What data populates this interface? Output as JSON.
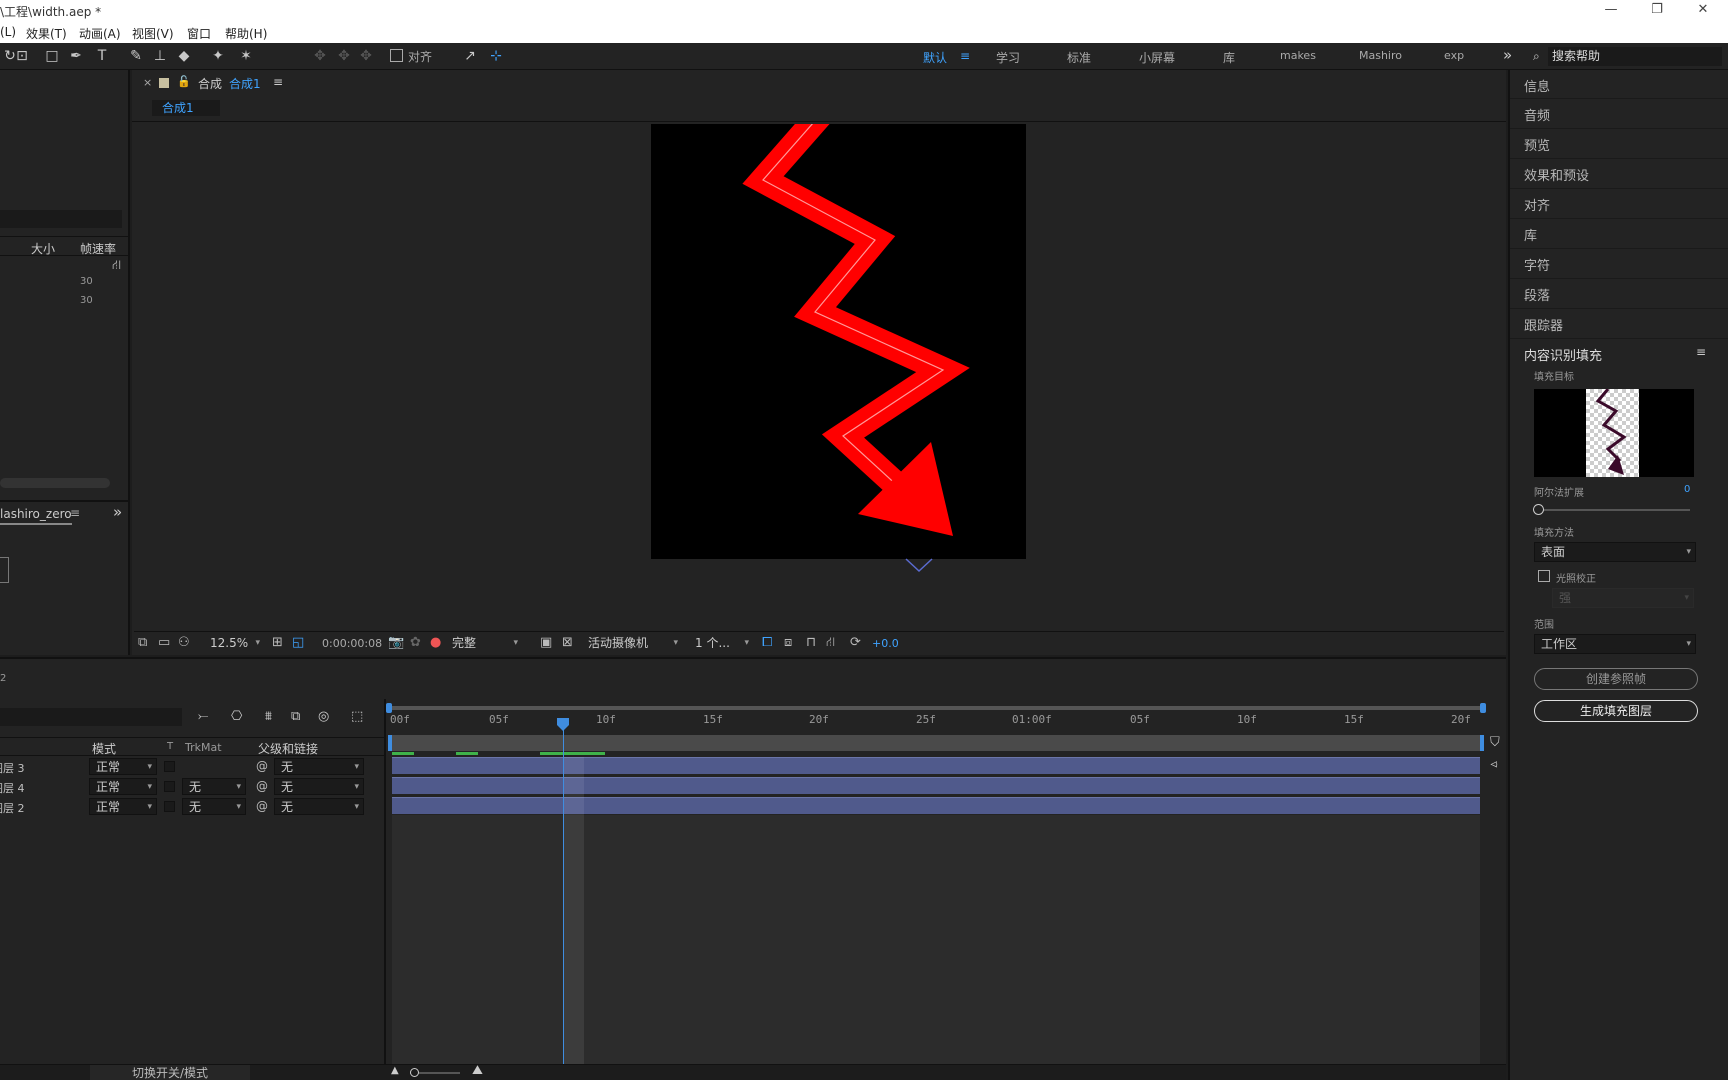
{
  "window": {
    "title": "\\工程\\width.aep *",
    "minimize": "—",
    "restore": "❐",
    "close": "✕"
  },
  "menu": [
    "(L)",
    "效果(T)",
    "动画(A)",
    "视图(V)",
    "窗口",
    "帮助(H)"
  ],
  "toolbar": {
    "align_label": "对齐",
    "workspaces": [
      "默认",
      "学习",
      "标准",
      "小屏幕",
      "库",
      "makes",
      "Mashiro",
      "exp"
    ],
    "more": "»",
    "search_placeholder": "搜索帮助"
  },
  "project": {
    "columns": [
      "大小",
      "帧速率"
    ],
    "rows": [
      "30",
      "30"
    ],
    "panel2_tab": "lashiro_zero",
    "panel2_more": "»"
  },
  "composition": {
    "tab_label": "合成",
    "tab_name": "合成1",
    "sub_tab": "合成1",
    "zoom": "12.5%",
    "timecode": "0:00:00:08",
    "resolution": "完整",
    "camera": "活动摄像机",
    "views": "1 个...",
    "exposure": "+0.0"
  },
  "right_panel": {
    "items": [
      "信息",
      "音频",
      "预览",
      "效果和预设",
      "对齐",
      "库",
      "字符",
      "段落",
      "跟踪器"
    ],
    "fill_section": "内容识别填充",
    "fill_target": "填充目标",
    "alpha_expand_label": "阿尔法扩展",
    "alpha_expand_value": "0",
    "alpha_expand_level": 0.0,
    "fill_method_label": "填充方法",
    "fill_method_value": "表面",
    "lighting_correction": "光照校正",
    "lighting_value": "强",
    "range_label": "范围",
    "range_value": "工作区",
    "create_ref_button": "创建参照帧",
    "generate_button": "生成填充图层"
  },
  "timeline": {
    "left_label": "2",
    "columns": {
      "mode": "模式",
      "t": "T",
      "trkmat": "TrkMat",
      "parent": "父级和链接"
    },
    "layers": [
      {
        "name": "图层 3",
        "mode": "正常",
        "trkmat": "",
        "parent": "无"
      },
      {
        "name": "图层 4",
        "mode": "正常",
        "trkmat": "无",
        "parent": "无"
      },
      {
        "name": "图层 2",
        "mode": "正常",
        "trkmat": "无",
        "parent": "无"
      }
    ],
    "ruler_ticks": [
      "00f",
      "05f",
      "10f",
      "15f",
      "20f",
      "25f",
      "01:00f",
      "05f",
      "10f",
      "15f",
      "20f"
    ],
    "toggle_label": "切换开关/模式"
  },
  "colors": {
    "accent": "#2d8ceb",
    "arrow_red": "#ff0000",
    "layer_bar": "#505a8c",
    "work_area_green": "#3fb24a"
  }
}
